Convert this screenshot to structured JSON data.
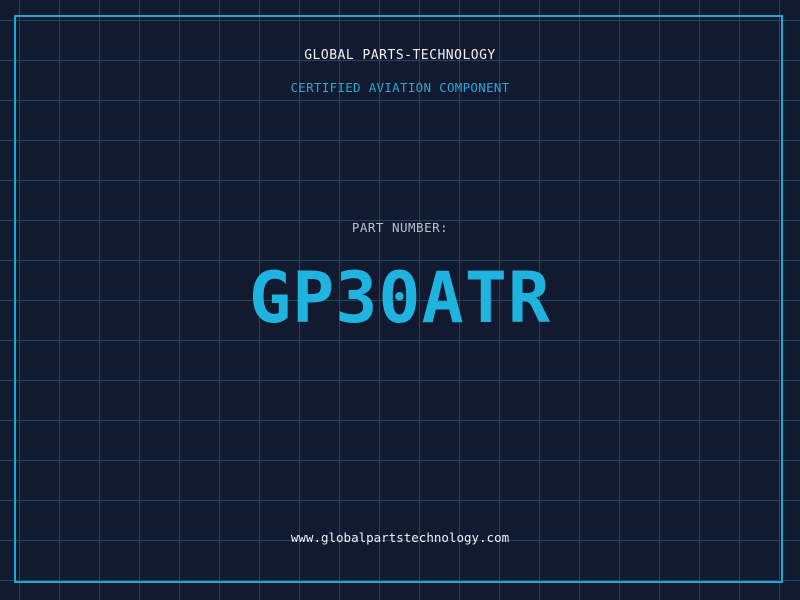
{
  "header": {
    "company": "GLOBAL PARTS-TECHNOLOGY",
    "subtitle": "CERTIFIED AVIATION COMPONENT"
  },
  "part": {
    "label": "PART NUMBER:",
    "number": "GP30ATR"
  },
  "footer": {
    "website": "www.globalpartstechnology.com"
  },
  "colors": {
    "background": "#111a2e",
    "grid": "#1d4a63",
    "accent": "#1fb4e0",
    "frame": "#1fa8d4"
  }
}
